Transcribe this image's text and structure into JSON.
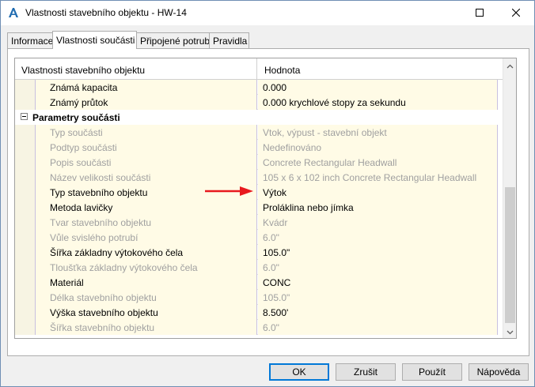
{
  "window": {
    "title": "Vlastnosti stavebního objektu - HW-14"
  },
  "tabs": [
    {
      "label": "Informace",
      "active": false
    },
    {
      "label": "Vlastnosti součásti",
      "active": true
    },
    {
      "label": "Připojené potrubí",
      "active": false
    },
    {
      "label": "Pravidla",
      "active": false
    }
  ],
  "grid": {
    "header": {
      "name": "Vlastnosti stavebního objektu",
      "value": "Hodnota"
    },
    "rows": [
      {
        "name": "Známá kapacita",
        "value": "0.000",
        "disabled": false
      },
      {
        "name": "Známý průtok",
        "value": "0.000 krychlové stopy za sekundu",
        "disabled": false
      },
      {
        "group": "Parametry součásti"
      },
      {
        "name": "Typ součásti",
        "value": "Vtok, výpust - stavební objekt",
        "disabled": true
      },
      {
        "name": "Podtyp součásti",
        "value": "Nedefinováno",
        "disabled": true
      },
      {
        "name": "Popis součásti",
        "value": "Concrete Rectangular Headwall",
        "disabled": true
      },
      {
        "name": "Název velikosti součásti",
        "value": "105 x 6 x 102 inch Concrete Rectangular Headwall",
        "disabled": true
      },
      {
        "name": "Typ stavebního objektu",
        "value": "Výtok",
        "disabled": false
      },
      {
        "name": "Metoda lavičky",
        "value": "Proláklina nebo jímka",
        "disabled": false
      },
      {
        "name": "Tvar stavebního objektu",
        "value": "Kvádr",
        "disabled": true
      },
      {
        "name": "Vůle svislého potrubí",
        "value": "6.0\"",
        "disabled": true
      },
      {
        "name": "Šířka základny výtokového čela",
        "value": "105.0\"",
        "disabled": false
      },
      {
        "name": "Tloušťka základny výtokového čela",
        "value": "6.0\"",
        "disabled": true
      },
      {
        "name": "Materiál",
        "value": "CONC",
        "disabled": false
      },
      {
        "name": "Délka stavebního objektu",
        "value": "105.0\"",
        "disabled": true
      },
      {
        "name": "Výška stavebního objektu",
        "value": "8.500'",
        "disabled": false
      },
      {
        "name": "Šířka stavebního objektu",
        "value": "6.0\"",
        "disabled": true
      }
    ]
  },
  "buttons": {
    "ok": "OK",
    "cancel": "Zrušit",
    "apply": "Použít",
    "help": "Nápověda"
  },
  "colors": {
    "accent": "#0078d7",
    "annotation_arrow": "#e8191e",
    "row_background": "#fffbe6",
    "disabled_text": "#a0a0a0"
  },
  "icons": {
    "app": "autocad-a-icon",
    "maximize": "maximize-icon",
    "close": "close-icon",
    "collapse": "minus-box-icon",
    "annotation": "red-arrow-icon"
  }
}
